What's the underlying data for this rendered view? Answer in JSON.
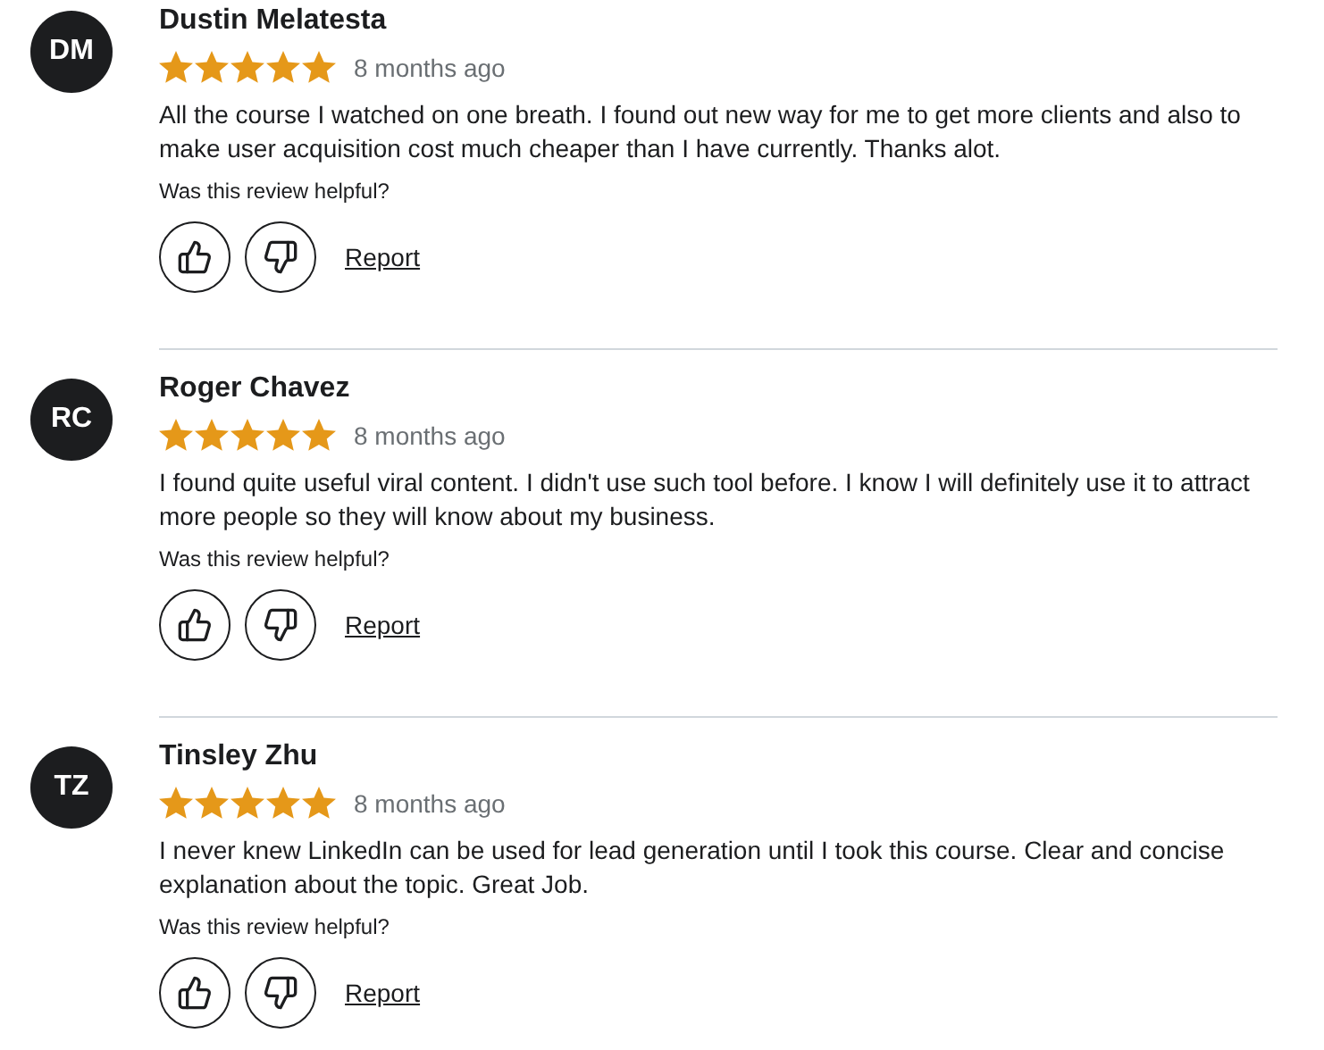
{
  "reviews": [
    {
      "initials": "DM",
      "name": "Dustin Melatesta",
      "stars": 5,
      "time": "8 months ago",
      "text": "All the course I watched on one breath. I found out new way for me to get more clients and also to make user acquisition cost much cheaper than I have currently. Thanks alot.",
      "helpful_prompt": "Was this review helpful?",
      "report": "Report"
    },
    {
      "initials": "RC",
      "name": "Roger Chavez",
      "stars": 5,
      "time": "8 months ago",
      "text": "I found quite useful viral content. I didn't use such tool before. I know I will definitely use it to attract more people so they will know about my business.",
      "helpful_prompt": "Was this review helpful?",
      "report": "Report"
    },
    {
      "initials": "TZ",
      "name": "Tinsley Zhu",
      "stars": 5,
      "time": "8 months ago",
      "text": "I never knew LinkedIn can be used for lead generation until I took this course. Clear and concise explanation about the topic. Great Job.",
      "helpful_prompt": "Was this review helpful?",
      "report": "Report"
    }
  ]
}
